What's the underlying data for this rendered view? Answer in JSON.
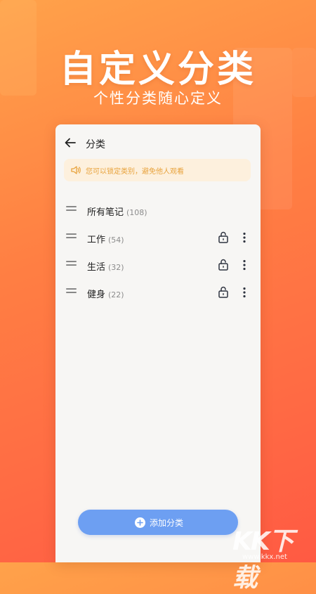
{
  "hero": {
    "title": "自定义分类",
    "subtitle": "个性分类随心定义"
  },
  "app": {
    "title": "分类",
    "notice": "您可以锁定类别，避免他人观看",
    "categories": [
      {
        "name": "所有笔记",
        "count": "(108)",
        "lock_icon": false,
        "more_icon": false
      },
      {
        "name": "工作",
        "count": "(54)",
        "lock_icon": "lock-open-icon",
        "more_icon": "more-vertical-icon"
      },
      {
        "name": "生活",
        "count": "(32)",
        "lock_icon": "lock-open-icon",
        "more_icon": "more-vertical-icon"
      },
      {
        "name": "健身",
        "count": "(22)",
        "lock_icon": "lock-open-icon",
        "more_icon": "more-vertical-icon"
      }
    ],
    "add_button": "添加分类"
  },
  "watermark": {
    "logo": "KK下载",
    "url": "www.kkx.net"
  },
  "icons": {
    "back": "arrow-left-icon",
    "notice": "speaker-icon",
    "drag": "drag-handle-icon",
    "add": "plus-circle-icon"
  },
  "colors": {
    "background_gradient_start": "#ffa24a",
    "background_gradient_end": "#ff5a43",
    "card": "#f7f6f4",
    "notice_bg": "#fdf0dd",
    "notice_text": "#e8a23b",
    "button": "#6d9ff2",
    "icon_dark": "#2f3440"
  }
}
